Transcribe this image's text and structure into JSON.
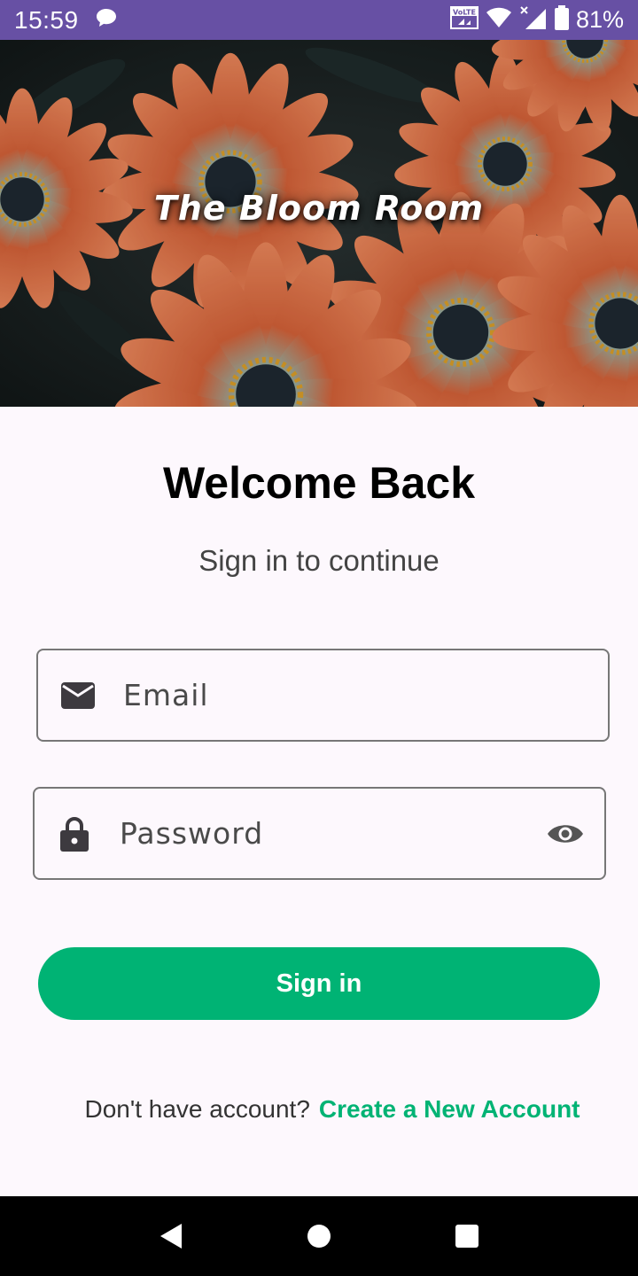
{
  "status_bar": {
    "time": "15:59",
    "battery_percent": "81%",
    "icons": [
      "chat-bubble-icon",
      "volte-icon",
      "wifi-icon",
      "signal-icon",
      "battery-icon"
    ]
  },
  "hero": {
    "title": "The Bloom Room"
  },
  "main": {
    "title": "Welcome Back",
    "subtitle": "Sign in to continue"
  },
  "form": {
    "email_placeholder": "Email",
    "email_value": "",
    "password_placeholder": "Password",
    "password_value": "",
    "signin_label": "Sign in"
  },
  "footer": {
    "prompt": "Don't have account?",
    "link_label": "Create a New Account"
  },
  "colors": {
    "status_bar": "#6750a4",
    "accent": "#00b374",
    "background": "#fdf8fd"
  }
}
